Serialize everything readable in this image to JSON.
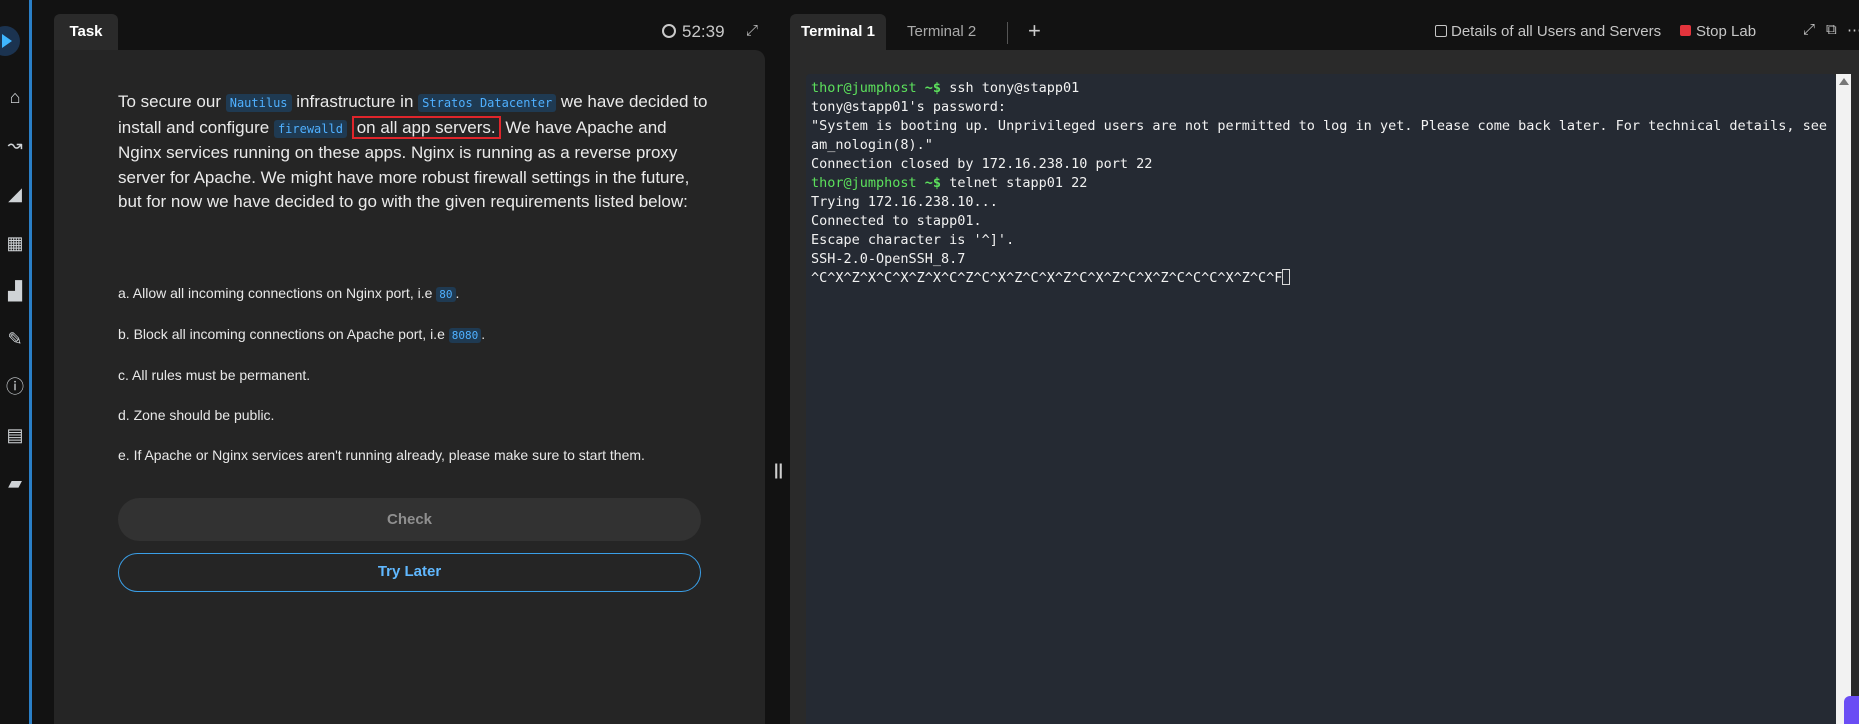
{
  "task": {
    "tab_label": "Task",
    "timer": "52:39",
    "intro_1": "To secure our ",
    "code_nautilus": "Nautilus",
    "intro_2": " infrastructure in ",
    "code_datacenter": "Stratos Datacenter",
    "intro_3": " we have decided to install and configure ",
    "code_firewalld": "firewalld",
    "highlight": "on all app servers.",
    "intro_4": " We have Apache and Nginx services running on these apps. Nginx is running as a reverse proxy server for Apache. We might have more robust firewall settings in the future, but for now we have decided to go with the given requirements listed below:",
    "req_a_text": "a. Allow all incoming connections on Nginx port, i.e ",
    "req_a_code": "80",
    "req_a_end": ".",
    "req_b_text": "b. Block all incoming connections on Apache port, i.e ",
    "req_b_code": "8080",
    "req_b_end": ".",
    "req_c": "c. All rules must be permanent.",
    "req_d": "d. Zone should be public.",
    "req_e": "e. If Apache or Nginx services aren't running already, please make sure to start them.",
    "check_label": "Check",
    "try_later_label": "Try Later"
  },
  "terminal": {
    "tab1_label": "Terminal 1",
    "tab2_label": "Terminal 2",
    "add_tab": "+",
    "details_label": "Details of all Users and Servers",
    "stop_lab_label": "Stop Lab",
    "prompt_user": "thor@jumphost",
    "prompt_path": " ~$",
    "cmd1": " ssh tony@stapp01",
    "line2": "tony@stapp01's password:",
    "line3": "\"System is booting up. Unprivileged users are not permitted to log in yet. Please come back later. For technical details, see p",
    "line4": "am_nologin(8).\"",
    "line5": "Connection closed by 172.16.238.10 port 22",
    "cmd2": " telnet stapp01 22",
    "line7": "Trying 172.16.238.10...",
    "line8": "Connected to stapp01.",
    "line9": "Escape character is '^]'.",
    "line10": "SSH-2.0-OpenSSH_8.7",
    "line11": "^C^X^Z^X^C^X^Z^X^C^Z^C^X^Z^C^X^Z^C^X^Z^C^X^Z^C^C^C^X^Z^C^F"
  },
  "colors": {
    "accent": "#3a9fe8",
    "prompt": "#5ce05c",
    "stop": "#e3343c",
    "highlight_box": "#e0252b"
  }
}
